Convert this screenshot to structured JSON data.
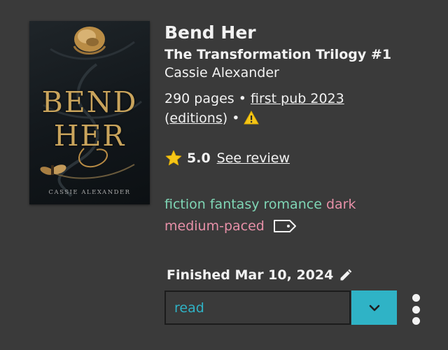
{
  "book": {
    "cover_title_line1": "BEND",
    "cover_title_line2": "HER",
    "cover_author": "CASSIE ALEXANDER",
    "title": "Bend Her",
    "series": "The Transformation Trilogy #1",
    "author": "Cassie Alexander",
    "pages": "290 pages",
    "separator": "•",
    "first_pub": "first pub 2023",
    "editions_open": "(",
    "editions": "editions",
    "editions_close": ")"
  },
  "rating": {
    "value": "5.0",
    "see_review": "See review"
  },
  "tags": [
    {
      "label": "fiction",
      "color": "#7fd6b5"
    },
    {
      "label": "fantasy",
      "color": "#7fd6b5"
    },
    {
      "label": "romance",
      "color": "#7fd6b5"
    },
    {
      "label": "dark",
      "color": "#e790a8"
    },
    {
      "label": "medium-paced",
      "color": "#e790a8"
    }
  ],
  "reading": {
    "finished_label": "Finished Mar 10, 2024",
    "status": "read"
  },
  "icons": {
    "warning": "warning-triangle",
    "star": "star",
    "tag": "tag-outline",
    "pencil": "pencil",
    "chevron": "chevron-down",
    "more": "more-vertical"
  },
  "colors": {
    "background": "#3a3a3a",
    "accent": "#2fb3c6",
    "teal_tag": "#7fd6b5",
    "pink_tag": "#e790a8",
    "star": "#f5c518",
    "warning": "#f5c518"
  }
}
